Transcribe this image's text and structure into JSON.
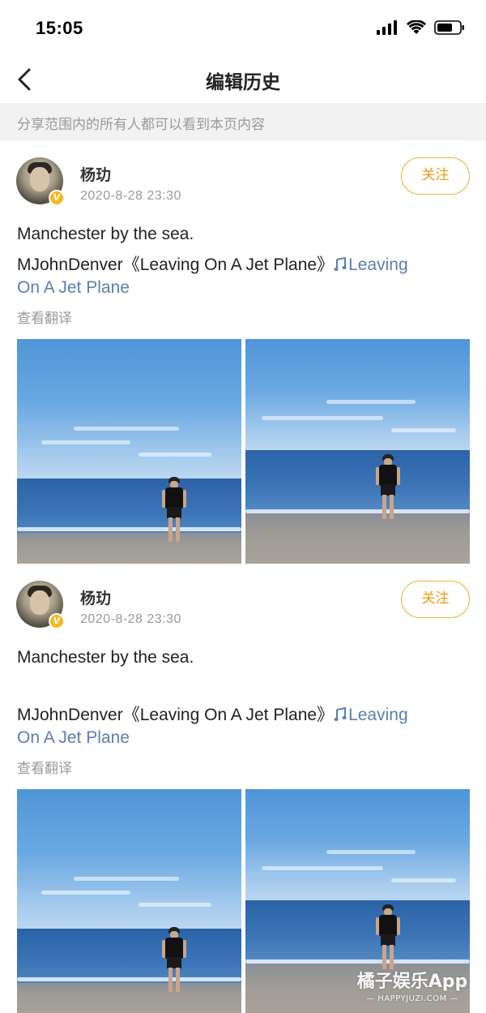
{
  "status_bar": {
    "time": "15:05",
    "icons": [
      "signal-icon",
      "wifi-icon",
      "battery-icon"
    ]
  },
  "nav": {
    "back_icon": "chevron-left-icon",
    "title": "编辑历史"
  },
  "notice": "分享范围内的所有人都可以看到本页内容",
  "posts": [
    {
      "username": "杨玏",
      "time": "2020-8-28 23:30",
      "verified_badge": "V",
      "follow_label": "关注",
      "text_line1": "Manchester by the sea.",
      "text_line2_prefix": "MJohnDenver《Leaving On A Jet Plane》",
      "music_link_part1": "Leaving",
      "music_link_part2": "On A Jet Plane",
      "translate_label": "查看翻译",
      "photos": [
        "beach-photo-1",
        "beach-photo-2"
      ]
    },
    {
      "username": "杨玏",
      "time": "2020-8-28 23:30",
      "verified_badge": "V",
      "follow_label": "关注",
      "text_line1": "Manchester by the sea.",
      "text_line2_prefix": "MJohnDenver《Leaving On A Jet Plane》",
      "music_link_part1": "Leaving",
      "music_link_part2": "On A Jet Plane",
      "translate_label": "查看翻译",
      "photos": [
        "beach-photo-1",
        "beach-photo-2"
      ]
    }
  ],
  "watermark": {
    "main": "橘子娱乐App",
    "sub": "— HAPPYJUZI.COM —"
  },
  "colors": {
    "accent_orange": "#f09a12",
    "follow_border": "#f0b437",
    "link_blue": "#5a7fb0",
    "verified_badge": "#f5b91f",
    "notice_bg": "#f2f2f2"
  }
}
